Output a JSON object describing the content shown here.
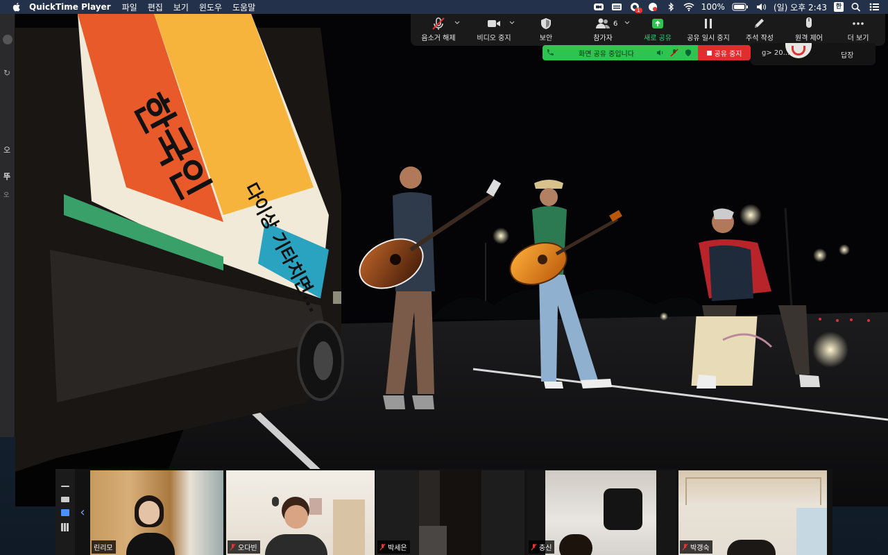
{
  "menubar": {
    "app_name": "QuickTime Player",
    "menus": [
      "파일",
      "편집",
      "보기",
      "윈도우",
      "도움말"
    ],
    "status_icons": [
      "zoom-icon",
      "screen-share-icon",
      "notification-icon",
      "camera-icon",
      "bluetooth-icon",
      "wifi-icon",
      "battery-icon",
      "volume-icon",
      "spotlight-icon",
      "control-center-icon"
    ],
    "notification_badge": "1",
    "battery": "100%",
    "datetime": "(일) 오후 2:43",
    "input_method": "한"
  },
  "background_window": {
    "fragments": [
      "오",
      "뚜",
      "오"
    ]
  },
  "zoom_toolbar": {
    "items": [
      {
        "label": "음소거 해제",
        "icon": "mic-muted-icon"
      },
      {
        "label": "비디오 중지",
        "icon": "video-camera-icon"
      },
      {
        "label": "보안",
        "icon": "shield-icon"
      },
      {
        "label": "참가자",
        "icon": "participants-icon",
        "count": "6"
      },
      {
        "label": "새로 공유",
        "icon": "share-screen-icon"
      },
      {
        "label": "공유 일시 중지",
        "icon": "pause-icon"
      },
      {
        "label": "주석 작성",
        "icon": "pencil-icon"
      },
      {
        "label": "원격 제어",
        "icon": "mouse-icon"
      },
      {
        "label": "더 보기",
        "icon": "more-icon"
      }
    ]
  },
  "share_status": {
    "sharing_text": "화면 공유 중입니다",
    "stop_label": "공유 중지"
  },
  "chat_peek": {
    "text": "g> 20...",
    "reply_label": "답장"
  },
  "video_overlay_text": {
    "truck_banner_1": "한국인",
    "truck_banner_2": "다이상 기타치면..."
  },
  "participants": [
    {
      "name": "린리모",
      "muted": false,
      "active": false
    },
    {
      "name": "오다빈",
      "muted": true,
      "active": true
    },
    {
      "name": "박세은",
      "muted": true,
      "active": false
    },
    {
      "name": "충신",
      "muted": true,
      "active": false
    },
    {
      "name": "박갱숙",
      "muted": true,
      "active": false
    }
  ],
  "colors": {
    "share_green": "#2fc44f",
    "stop_red": "#e02d2d",
    "toolbar_bg": "#1a1a1a",
    "active_speaker": "#c9e26a"
  }
}
